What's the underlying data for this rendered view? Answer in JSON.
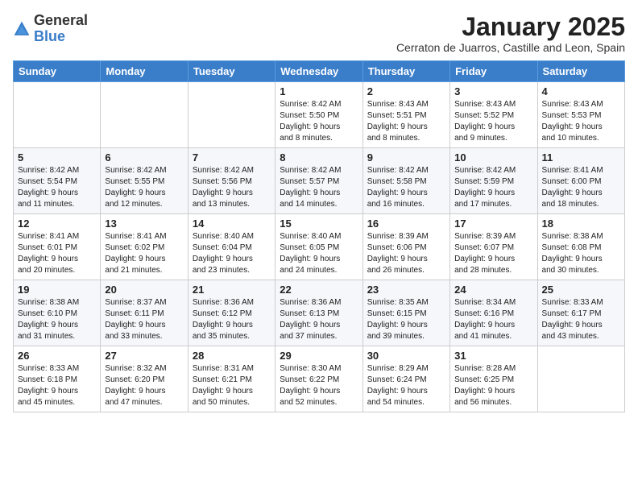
{
  "logo": {
    "general": "General",
    "blue": "Blue"
  },
  "header": {
    "month_title": "January 2025",
    "subtitle": "Cerraton de Juarros, Castille and Leon, Spain"
  },
  "days_of_week": [
    "Sunday",
    "Monday",
    "Tuesday",
    "Wednesday",
    "Thursday",
    "Friday",
    "Saturday"
  ],
  "weeks": [
    [
      {
        "day": "",
        "content": ""
      },
      {
        "day": "",
        "content": ""
      },
      {
        "day": "",
        "content": ""
      },
      {
        "day": "1",
        "content": "Sunrise: 8:42 AM\nSunset: 5:50 PM\nDaylight: 9 hours\nand 8 minutes."
      },
      {
        "day": "2",
        "content": "Sunrise: 8:43 AM\nSunset: 5:51 PM\nDaylight: 9 hours\nand 8 minutes."
      },
      {
        "day": "3",
        "content": "Sunrise: 8:43 AM\nSunset: 5:52 PM\nDaylight: 9 hours\nand 9 minutes."
      },
      {
        "day": "4",
        "content": "Sunrise: 8:43 AM\nSunset: 5:53 PM\nDaylight: 9 hours\nand 10 minutes."
      }
    ],
    [
      {
        "day": "5",
        "content": "Sunrise: 8:42 AM\nSunset: 5:54 PM\nDaylight: 9 hours\nand 11 minutes."
      },
      {
        "day": "6",
        "content": "Sunrise: 8:42 AM\nSunset: 5:55 PM\nDaylight: 9 hours\nand 12 minutes."
      },
      {
        "day": "7",
        "content": "Sunrise: 8:42 AM\nSunset: 5:56 PM\nDaylight: 9 hours\nand 13 minutes."
      },
      {
        "day": "8",
        "content": "Sunrise: 8:42 AM\nSunset: 5:57 PM\nDaylight: 9 hours\nand 14 minutes."
      },
      {
        "day": "9",
        "content": "Sunrise: 8:42 AM\nSunset: 5:58 PM\nDaylight: 9 hours\nand 16 minutes."
      },
      {
        "day": "10",
        "content": "Sunrise: 8:42 AM\nSunset: 5:59 PM\nDaylight: 9 hours\nand 17 minutes."
      },
      {
        "day": "11",
        "content": "Sunrise: 8:41 AM\nSunset: 6:00 PM\nDaylight: 9 hours\nand 18 minutes."
      }
    ],
    [
      {
        "day": "12",
        "content": "Sunrise: 8:41 AM\nSunset: 6:01 PM\nDaylight: 9 hours\nand 20 minutes."
      },
      {
        "day": "13",
        "content": "Sunrise: 8:41 AM\nSunset: 6:02 PM\nDaylight: 9 hours\nand 21 minutes."
      },
      {
        "day": "14",
        "content": "Sunrise: 8:40 AM\nSunset: 6:04 PM\nDaylight: 9 hours\nand 23 minutes."
      },
      {
        "day": "15",
        "content": "Sunrise: 8:40 AM\nSunset: 6:05 PM\nDaylight: 9 hours\nand 24 minutes."
      },
      {
        "day": "16",
        "content": "Sunrise: 8:39 AM\nSunset: 6:06 PM\nDaylight: 9 hours\nand 26 minutes."
      },
      {
        "day": "17",
        "content": "Sunrise: 8:39 AM\nSunset: 6:07 PM\nDaylight: 9 hours\nand 28 minutes."
      },
      {
        "day": "18",
        "content": "Sunrise: 8:38 AM\nSunset: 6:08 PM\nDaylight: 9 hours\nand 30 minutes."
      }
    ],
    [
      {
        "day": "19",
        "content": "Sunrise: 8:38 AM\nSunset: 6:10 PM\nDaylight: 9 hours\nand 31 minutes."
      },
      {
        "day": "20",
        "content": "Sunrise: 8:37 AM\nSunset: 6:11 PM\nDaylight: 9 hours\nand 33 minutes."
      },
      {
        "day": "21",
        "content": "Sunrise: 8:36 AM\nSunset: 6:12 PM\nDaylight: 9 hours\nand 35 minutes."
      },
      {
        "day": "22",
        "content": "Sunrise: 8:36 AM\nSunset: 6:13 PM\nDaylight: 9 hours\nand 37 minutes."
      },
      {
        "day": "23",
        "content": "Sunrise: 8:35 AM\nSunset: 6:15 PM\nDaylight: 9 hours\nand 39 minutes."
      },
      {
        "day": "24",
        "content": "Sunrise: 8:34 AM\nSunset: 6:16 PM\nDaylight: 9 hours\nand 41 minutes."
      },
      {
        "day": "25",
        "content": "Sunrise: 8:33 AM\nSunset: 6:17 PM\nDaylight: 9 hours\nand 43 minutes."
      }
    ],
    [
      {
        "day": "26",
        "content": "Sunrise: 8:33 AM\nSunset: 6:18 PM\nDaylight: 9 hours\nand 45 minutes."
      },
      {
        "day": "27",
        "content": "Sunrise: 8:32 AM\nSunset: 6:20 PM\nDaylight: 9 hours\nand 47 minutes."
      },
      {
        "day": "28",
        "content": "Sunrise: 8:31 AM\nSunset: 6:21 PM\nDaylight: 9 hours\nand 50 minutes."
      },
      {
        "day": "29",
        "content": "Sunrise: 8:30 AM\nSunset: 6:22 PM\nDaylight: 9 hours\nand 52 minutes."
      },
      {
        "day": "30",
        "content": "Sunrise: 8:29 AM\nSunset: 6:24 PM\nDaylight: 9 hours\nand 54 minutes."
      },
      {
        "day": "31",
        "content": "Sunrise: 8:28 AM\nSunset: 6:25 PM\nDaylight: 9 hours\nand 56 minutes."
      },
      {
        "day": "",
        "content": ""
      }
    ]
  ]
}
